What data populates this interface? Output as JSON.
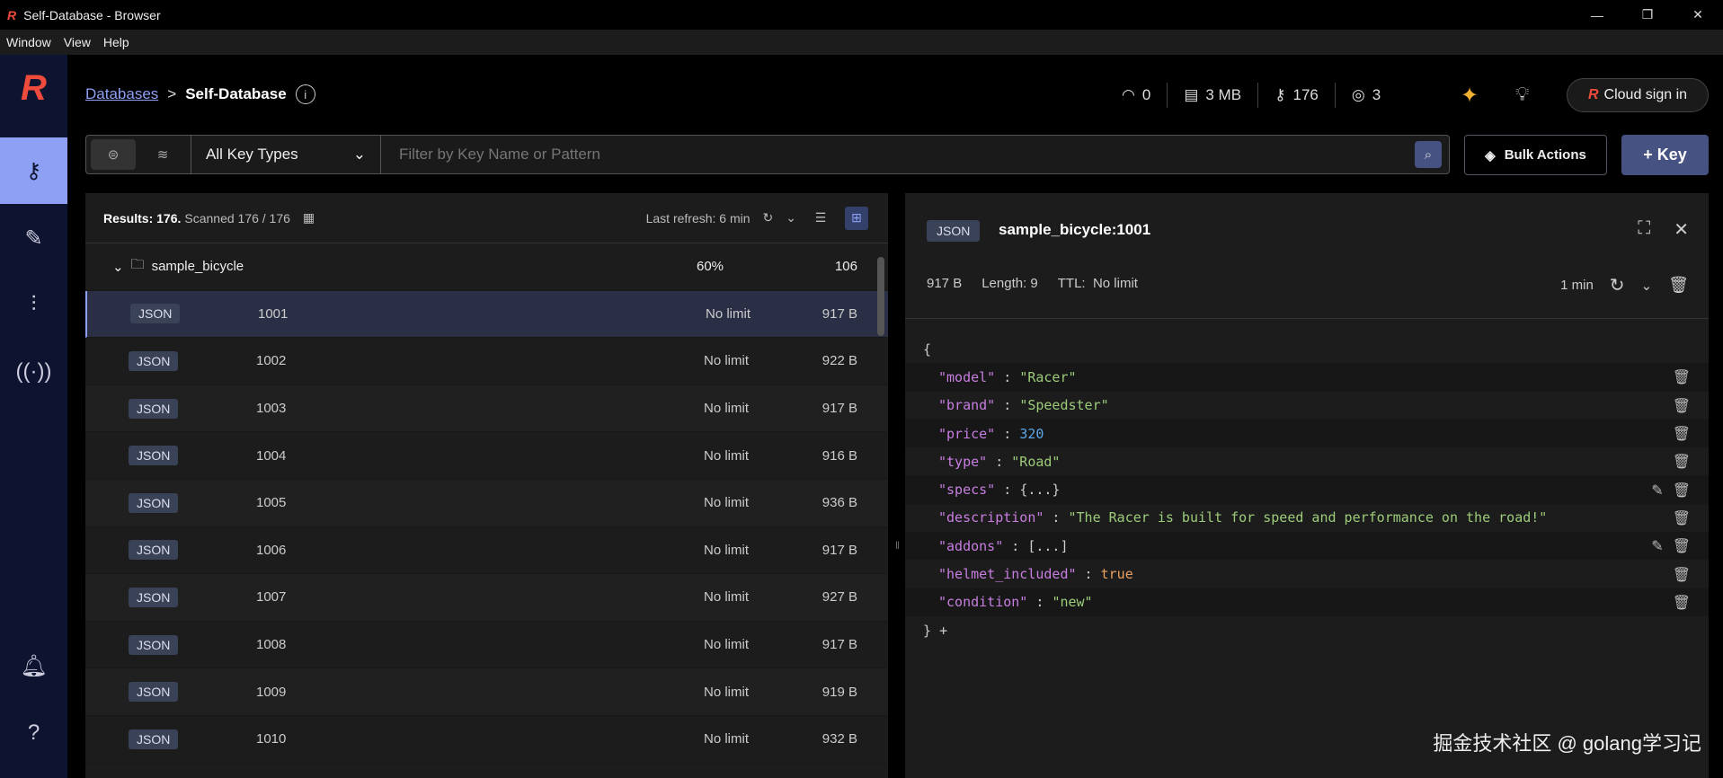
{
  "window": {
    "title": "Self-Database - Browser",
    "menu": [
      "Window",
      "View",
      "Help"
    ]
  },
  "breadcrumb": {
    "parent": "Databases",
    "sep": ">",
    "current": "Self-Database"
  },
  "stats": {
    "ops": "0",
    "memory": "3 MB",
    "keys": "176",
    "clients": "3"
  },
  "cloud_sign_in": "Cloud sign in",
  "filter": {
    "key_type": "All Key Types",
    "placeholder": "Filter by Key Name or Pattern"
  },
  "bulk_actions": "Bulk Actions",
  "add_key": "+ Key",
  "list": {
    "results_label": "Results: 176.",
    "scanned": "Scanned 176 / 176",
    "last_refresh": "Last refresh: 6 min",
    "folder": {
      "name": "sample_bicycle",
      "percent": "60%",
      "count": "106"
    },
    "rows": [
      {
        "type": "JSON",
        "name": "1001",
        "ttl": "No limit",
        "size": "917 B"
      },
      {
        "type": "JSON",
        "name": "1002",
        "ttl": "No limit",
        "size": "922 B"
      },
      {
        "type": "JSON",
        "name": "1003",
        "ttl": "No limit",
        "size": "917 B"
      },
      {
        "type": "JSON",
        "name": "1004",
        "ttl": "No limit",
        "size": "916 B"
      },
      {
        "type": "JSON",
        "name": "1005",
        "ttl": "No limit",
        "size": "936 B"
      },
      {
        "type": "JSON",
        "name": "1006",
        "ttl": "No limit",
        "size": "917 B"
      },
      {
        "type": "JSON",
        "name": "1007",
        "ttl": "No limit",
        "size": "927 B"
      },
      {
        "type": "JSON",
        "name": "1008",
        "ttl": "No limit",
        "size": "917 B"
      },
      {
        "type": "JSON",
        "name": "1009",
        "ttl": "No limit",
        "size": "919 B"
      },
      {
        "type": "JSON",
        "name": "1010",
        "ttl": "No limit",
        "size": "932 B"
      }
    ]
  },
  "details": {
    "type": "JSON",
    "key": "sample_bicycle:1001",
    "size": "917 B",
    "length": "Length: 9",
    "ttl_label": "TTL:",
    "ttl": "No limit",
    "refresh": "1 min",
    "open": "{",
    "close": "}",
    "add": "+",
    "fields": [
      {
        "key": "\"model\"",
        "value": "\"Racer\"",
        "kind": "s",
        "edit": false
      },
      {
        "key": "\"brand\"",
        "value": "\"Speedster\"",
        "kind": "s",
        "edit": false
      },
      {
        "key": "\"price\"",
        "value": "320",
        "kind": "n",
        "edit": false
      },
      {
        "key": "\"type\"",
        "value": "\"Road\"",
        "kind": "s",
        "edit": false
      },
      {
        "key": "\"specs\"",
        "value": "{...}",
        "kind": "p",
        "edit": true
      },
      {
        "key": "\"description\"",
        "value": "\"The Racer is built for speed and performance on the road!\"",
        "kind": "s",
        "edit": false
      },
      {
        "key": "\"addons\"",
        "value": "[...]",
        "kind": "p",
        "edit": true
      },
      {
        "key": "\"helmet_included\"",
        "value": "true",
        "kind": "b",
        "edit": false
      },
      {
        "key": "\"condition\"",
        "value": "\"new\"",
        "kind": "s",
        "edit": false
      }
    ]
  },
  "watermark": "掘金技术社区 @ golang学习记"
}
